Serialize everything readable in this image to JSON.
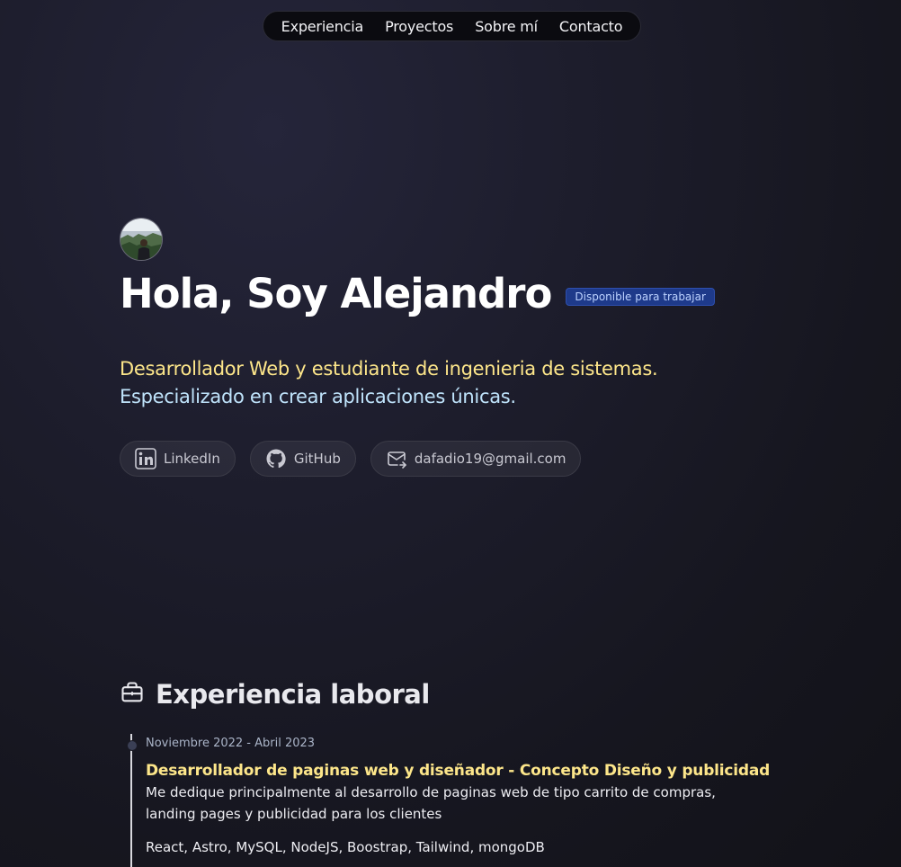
{
  "nav": {
    "items": [
      {
        "label": "Experiencia"
      },
      {
        "label": "Proyectos"
      },
      {
        "label": "Sobre mí"
      },
      {
        "label": "Contacto"
      }
    ]
  },
  "hero": {
    "title": "Hola, Soy Alejandro",
    "badge": "Disponible para trabajar",
    "desc_part1": "Desarrollador Web y estudiante de ingenieria de sistemas.",
    "desc_part2": "Especializado en crear aplicaciones únicas."
  },
  "social": {
    "linkedin": "LinkedIn",
    "github": "GitHub",
    "email": "dafadio19@gmail.com"
  },
  "experience": {
    "title": "Experiencia laboral",
    "jobs": [
      {
        "date": "Noviembre 2022 - Abril 2023",
        "title": "Desarrollador de paginas web y diseñador - Concepto Diseño y publicidad",
        "description": "Me dedique principalmente al desarrollo de paginas web de tipo carrito de compras, landing pages y publicidad para los clientes",
        "tech": "React, Astro, MySQL, NodeJS, Boostrap, Tailwind, mongoDB"
      }
    ]
  },
  "colors": {
    "accent_yellow": "#fde68a",
    "accent_blue": "#bfe3fb",
    "badge_bg": "#1e3a8a"
  },
  "icons": [
    "linkedin-icon",
    "github-icon",
    "mail-icon",
    "briefcase-icon"
  ]
}
